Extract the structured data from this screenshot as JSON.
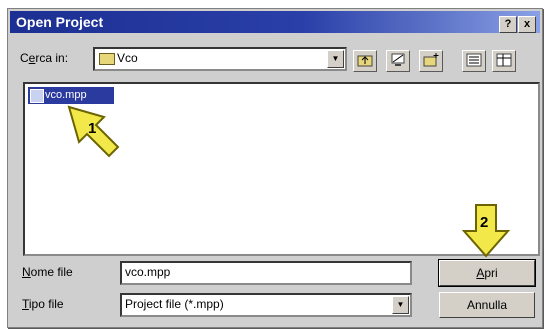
{
  "window": {
    "title": "Open Project",
    "help_label": "?",
    "close_label": "x"
  },
  "look_in": {
    "label_prefix": "C",
    "label_underlined": "e",
    "label_rest": "rca in:",
    "value": "Vco"
  },
  "toolbar": {
    "icons": [
      "up-folder-icon",
      "desktop-icon",
      "new-folder-icon",
      "list-view-icon",
      "details-view-icon"
    ]
  },
  "files": [
    {
      "name": "vco.mpp"
    }
  ],
  "filename": {
    "label_underlined": "N",
    "label_rest": "ome file",
    "value": "vco.mpp"
  },
  "filetype": {
    "label_underlined": "T",
    "label_rest": "ipo file",
    "value": "Project file (*.mpp)"
  },
  "buttons": {
    "open_underlined": "A",
    "open_rest": "pri",
    "cancel": "Annulla"
  },
  "annotations": [
    {
      "number": "1"
    },
    {
      "number": "2"
    }
  ],
  "colors": {
    "titlebar": "#1c2f92",
    "selection": "#2b3a9e",
    "marker_yellow": "#f2e84a"
  }
}
